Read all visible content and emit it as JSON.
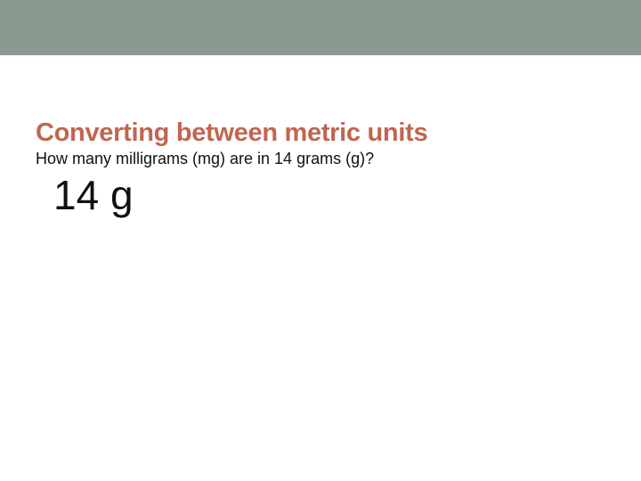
{
  "slide": {
    "heading": "Converting between metric units",
    "question": "How many milligrams (mg) are in 14 grams (g)?",
    "value_display": "14 g"
  }
}
